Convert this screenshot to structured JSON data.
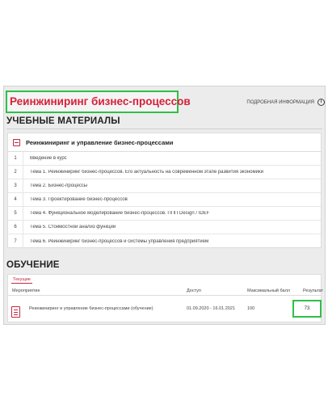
{
  "header": {
    "course_title": "Реинжиниринг бизнес-процессов",
    "more_info_label": "ПОДРОБНАЯ ИНФОРМАЦИЯ",
    "info_icon": "info-circle-icon"
  },
  "materials": {
    "heading": "УЧЕБНЫЕ МАТЕРИАЛЫ",
    "card_title": "Реинжиниринг и управление бизнес-процессами",
    "items": [
      {
        "num": "1",
        "text": "Введение в курс"
      },
      {
        "num": "2",
        "text": "Тема 1. Реинжиниринг бизнес-процессов. Его актуальность на современном этапе развития экономики"
      },
      {
        "num": "3",
        "text": "Тема 2. Бизнес-процессы"
      },
      {
        "num": "4",
        "text": "Тема 3. Проектирование бизнес-процессов"
      },
      {
        "num": "5",
        "text": "Тема 4. Функциональное моделирование бизнес-процессов. ППП Design / IDEF"
      },
      {
        "num": "6",
        "text": "Тема 5. Стоимостной анализ функций"
      },
      {
        "num": "7",
        "text": "Тема 6. Реинжиниринг бизнес-процессов и системы управления предприятием"
      }
    ]
  },
  "training": {
    "heading": "ОБУЧЕНИЕ",
    "tab_current": "Текущие",
    "columns": {
      "event": "Мероприятие",
      "access": "Доступ",
      "max_score": "Максимальный балл",
      "result": "Результат"
    },
    "row": {
      "event": "Реинжиниринг и управление бизнес-процессами (обучение)",
      "access": "01.09.2020 - 16.01.2021",
      "max_score": "100",
      "result": "73"
    }
  },
  "colors": {
    "accent": "#c02841",
    "highlight": "#2fbf4a"
  }
}
